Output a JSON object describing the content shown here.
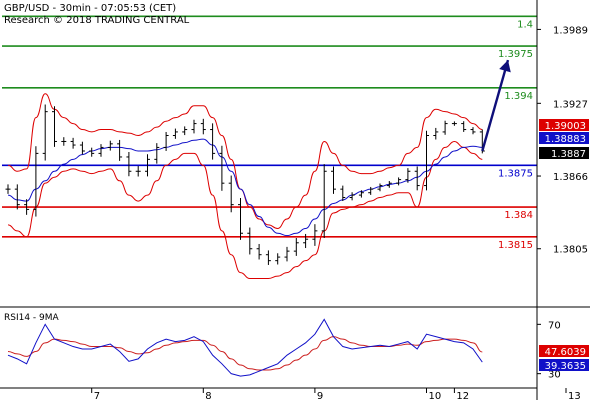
{
  "header": {
    "line1": "GBP/USD - 30min - 07:05:53 (CET)",
    "line2": "Research © 2018 TRADING CENTRAL"
  },
  "rsi_label": "RSI14 - 9MA",
  "colors": {
    "resistance": "#1e8c1e",
    "pivot": "#0000cc",
    "support": "#dd0000",
    "bollinger": "#dd0000",
    "moving_average": "#1010c8",
    "price_bars": "#000000",
    "projection_arrow": "#0f0f7a",
    "rsi_line": "#1010c8",
    "rsi_ma": "#cc2020"
  },
  "chart_data": [
    {
      "type": "line",
      "y_ticks": [
        1.3989,
        1.3927,
        1.3866,
        1.3805
      ],
      "ylim": [
        1.3762,
        1.4012
      ],
      "x_ticks": [
        "7",
        "8",
        "9",
        "10",
        "12",
        "13"
      ],
      "x_tick_index": [
        9,
        21,
        33,
        45,
        48,
        60
      ],
      "levels": [
        {
          "kind": "resistance",
          "label": "1.4",
          "value": 1.4
        },
        {
          "kind": "resistance",
          "label": "1.3975",
          "value": 1.3975
        },
        {
          "kind": "resistance",
          "label": "1.394",
          "value": 1.394
        },
        {
          "kind": "pivot",
          "label": "1.3875",
          "value": 1.3875
        },
        {
          "kind": "support",
          "label": "1.384",
          "value": 1.384
        },
        {
          "kind": "support",
          "label": "1.3815",
          "value": 1.3815
        }
      ],
      "price_tags": [
        {
          "label": "1.39003",
          "value": 1.39003,
          "bg": "#dd0000",
          "fg": "#ffffff"
        },
        {
          "label": "1.38883",
          "value": 1.38883,
          "bg": "#1010c8",
          "fg": "#ffffff"
        },
        {
          "label": "1.3887",
          "value": 1.3887,
          "bg": "#000000",
          "fg": "#ffffff"
        }
      ],
      "series": [
        {
          "values": [
            1.3855,
            1.3842,
            1.3838,
            1.3885,
            1.392,
            1.3895,
            1.3895,
            1.3892,
            1.3887,
            1.3885,
            1.389,
            1.3893,
            1.3882,
            1.387,
            1.387,
            1.388,
            1.389,
            1.39,
            1.3903,
            1.3905,
            1.391,
            1.3905,
            1.3885,
            1.386,
            1.3842,
            1.3818,
            1.3805,
            1.38,
            1.3795,
            1.3798,
            1.3803,
            1.381,
            1.3813,
            1.382,
            1.387,
            1.3855,
            1.3848,
            1.385,
            1.3852,
            1.3855,
            1.3858,
            1.386,
            1.3863,
            1.387,
            1.3858,
            1.39,
            1.3903,
            1.391,
            1.391,
            1.3905,
            1.3903,
            1.3887
          ]
        },
        {
          "values": [
            1.385,
            1.3846,
            1.3845,
            1.3855,
            1.3862,
            1.387,
            1.3876,
            1.388,
            1.3884,
            1.3887,
            1.3889,
            1.389,
            1.389,
            1.3889,
            1.3887,
            1.3887,
            1.3888,
            1.389,
            1.3892,
            1.3894,
            1.3896,
            1.3897,
            1.3892,
            1.3882,
            1.387,
            1.3855,
            1.3842,
            1.3832,
            1.3823,
            1.3818,
            1.3816,
            1.3818,
            1.3822,
            1.383,
            1.3838,
            1.3843,
            1.3846,
            1.385,
            1.3853,
            1.3855,
            1.3857,
            1.3859,
            1.386,
            1.3862,
            1.3865,
            1.387,
            1.3876,
            1.3882,
            1.3887,
            1.389,
            1.3891,
            1.389
          ]
        },
        {
          "values": [
            1.3875,
            1.387,
            1.3872,
            1.3915,
            1.3935,
            1.3922,
            1.3915,
            1.391,
            1.3905,
            1.3903,
            1.3905,
            1.3905,
            1.3903,
            1.3902,
            1.39,
            1.3903,
            1.3907,
            1.3912,
            1.3915,
            1.3918,
            1.3925,
            1.3925,
            1.3915,
            1.39,
            1.388,
            1.3855,
            1.384,
            1.383,
            1.3825,
            1.3822,
            1.383,
            1.384,
            1.385,
            1.387,
            1.3895,
            1.3885,
            1.3875,
            1.387,
            1.3868,
            1.3868,
            1.387,
            1.3873,
            1.3875,
            1.3885,
            1.389,
            1.3915,
            1.3922,
            1.392,
            1.3918,
            1.3915,
            1.391,
            1.3905
          ]
        },
        {
          "values": [
            1.3825,
            1.382,
            1.3815,
            1.384,
            1.386,
            1.3865,
            1.387,
            1.3872,
            1.387,
            1.3868,
            1.387,
            1.3872,
            1.3862,
            1.385,
            1.3845,
            1.385,
            1.3862,
            1.3875,
            1.388,
            1.3885,
            1.3885,
            1.3875,
            1.385,
            1.382,
            1.38,
            1.3785,
            1.378,
            1.378,
            1.378,
            1.3782,
            1.3785,
            1.379,
            1.3795,
            1.38,
            1.382,
            1.3835,
            1.3838,
            1.384,
            1.3842,
            1.3845,
            1.3848,
            1.385,
            1.3852,
            1.3852,
            1.384,
            1.3865,
            1.388,
            1.389,
            1.3895,
            1.389,
            1.3885,
            1.388
          ]
        },
        {
          "values": [
            1.3887,
            1.3975
          ]
        }
      ]
    },
    {
      "type": "line",
      "y_ticks": [
        70,
        30
      ],
      "ylim": [
        20,
        80
      ],
      "price_tags": [
        {
          "label": "47.6039",
          "value": 47.6039,
          "bg": "#dd0000",
          "fg": "#ffffff"
        },
        {
          "label": "39.3635",
          "value": 39.3635,
          "bg": "#1010c8",
          "fg": "#ffffff"
        }
      ],
      "series": [
        {
          "values": [
            45,
            42,
            38,
            55,
            70,
            58,
            55,
            52,
            50,
            50,
            52,
            54,
            48,
            40,
            42,
            50,
            55,
            58,
            56,
            57,
            60,
            56,
            45,
            38,
            30,
            28,
            29,
            32,
            35,
            38,
            45,
            50,
            55,
            62,
            74,
            60,
            52,
            50,
            51,
            52,
            53,
            52,
            54,
            56,
            50,
            62,
            60,
            58,
            56,
            55,
            50,
            39.3635
          ]
        },
        {
          "values": [
            48,
            46,
            44,
            48,
            55,
            58,
            57,
            56,
            54,
            52,
            52,
            52,
            51,
            48,
            46,
            47,
            50,
            53,
            55,
            56,
            57,
            57,
            53,
            48,
            42,
            37,
            34,
            33,
            33,
            34,
            37,
            41,
            45,
            50,
            57,
            60,
            58,
            55,
            53,
            52,
            52,
            52,
            53,
            54,
            53,
            56,
            57,
            58,
            58,
            57,
            55,
            47.6039
          ]
        }
      ]
    }
  ]
}
